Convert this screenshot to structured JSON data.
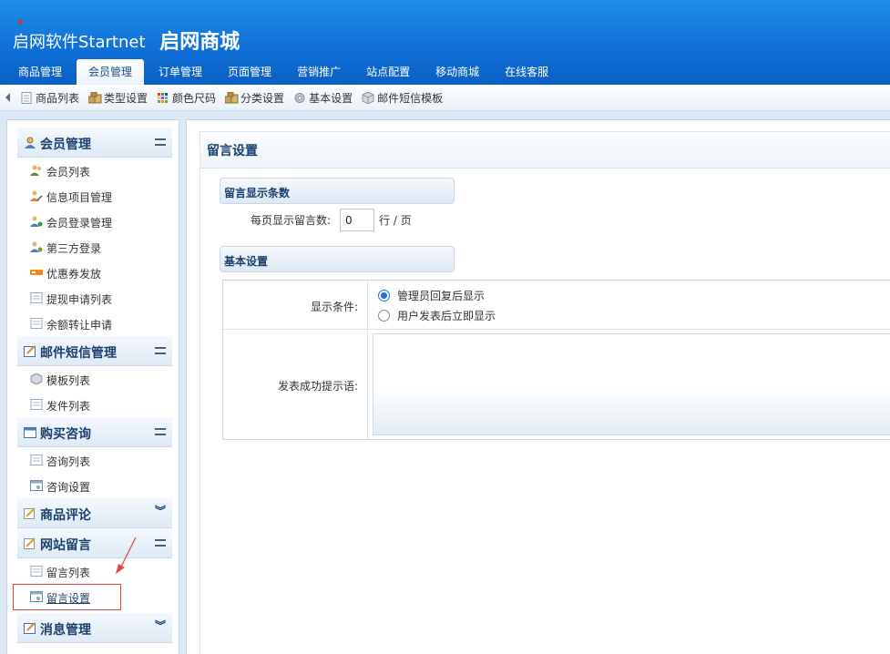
{
  "header": {
    "brand": "启网软件Startnet",
    "site_name": "启网商城",
    "tabs": [
      "商品管理",
      "会员管理",
      "订单管理",
      "页面管理",
      "营销推广",
      "站点配置",
      "移动商城",
      "在线客服"
    ],
    "active_tab": "会员管理"
  },
  "subbar": {
    "items": [
      "商品列表",
      "类型设置",
      "颜色尺码",
      "分类设置",
      "基本设置",
      "邮件短信模板"
    ]
  },
  "sidebar": {
    "groups": [
      {
        "title": "会员管理",
        "toggle": "collapse",
        "items": [
          "会员列表",
          "信息项目管理",
          "会员登录管理",
          "第三方登录",
          "优惠券发放",
          "提现申请列表",
          "余额转让申请"
        ]
      },
      {
        "title": "邮件短信管理",
        "toggle": "collapse",
        "items": [
          "模板列表",
          "发件列表"
        ]
      },
      {
        "title": "购买咨询",
        "toggle": "collapse",
        "items": [
          "咨询列表",
          "咨询设置"
        ]
      },
      {
        "title": "商品评论",
        "toggle": "expand",
        "items": []
      },
      {
        "title": "网站留言",
        "toggle": "collapse",
        "items": [
          "留言列表",
          "留言设置"
        ]
      },
      {
        "title": "消息管理",
        "toggle": "expand",
        "items": []
      }
    ],
    "highlighted_item": "留言设置"
  },
  "main": {
    "title": "留言设置",
    "section_display_count": "留言显示条数",
    "per_page_label": "每页显示留言数:",
    "per_page_value": "0",
    "per_page_unit": "行 / 页",
    "section_basic": "基本设置",
    "display_condition_label": "显示条件:",
    "display_options": [
      "管理员回复后显示",
      "用户发表后立即显示"
    ],
    "display_selected": "管理员回复后显示",
    "success_tip_label": "发表成功提示语:",
    "success_tip_value": ""
  },
  "colors": {
    "header_blue": "#0f6fd6",
    "title_text": "#1b3e6e",
    "highlight_border": "#e24848",
    "radio_checked": "#1a73e8"
  }
}
